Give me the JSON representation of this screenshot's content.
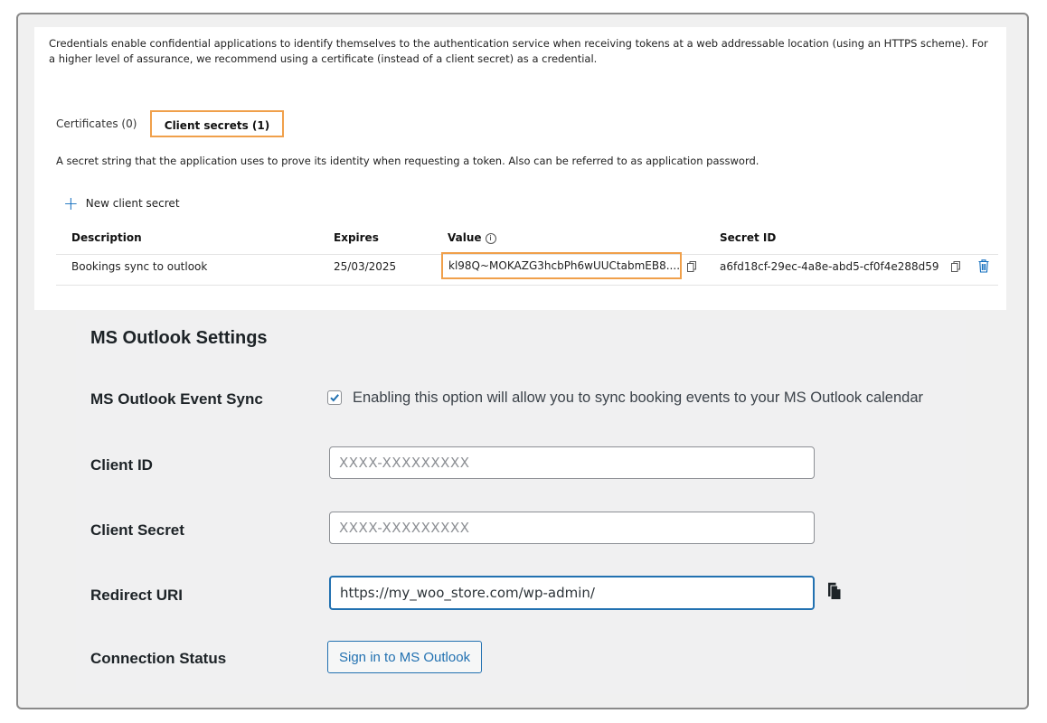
{
  "azure": {
    "intro_text": "Credentials enable confidential applications to identify themselves to the authentication service when receiving tokens at a web addressable location (using an HTTPS scheme). For a higher level of assurance, we recommend using a certificate (instead of a client secret) as a credential.",
    "tabs": [
      {
        "label": "Certificates (0)",
        "selected": false
      },
      {
        "label": "Client secrets (1)",
        "selected": true
      }
    ],
    "secrets_description": "A secret string that the application uses to prove its identity when requesting a token. Also can be referred to as application password.",
    "new_secret_label": "New client secret",
    "table": {
      "headers": {
        "description": "Description",
        "expires": "Expires",
        "value": "Value",
        "secret_id": "Secret ID"
      },
      "rows": [
        {
          "description": "Bookings sync to outlook",
          "expires": "25/03/2025",
          "value": "kl98Q~MOKAZG3hcbPh6wUUCtabmEB8....",
          "secret_id": "a6fd18cf-29ec-4a8e-abd5-cf0f4e288d59"
        }
      ]
    },
    "icons": {
      "add": "plus-icon",
      "info": "info-icon",
      "copy": "copy-icon",
      "delete": "trash-icon"
    },
    "accent_color": "#0f6cbd",
    "highlight_color": "#f0a04b"
  },
  "settings": {
    "title": "MS Outlook Settings",
    "event_sync": {
      "label": "MS Outlook Event Sync",
      "checked": true,
      "text": "Enabling this option will allow you to sync booking events to your MS Outlook calendar"
    },
    "client_id": {
      "label": "Client ID",
      "value": "",
      "placeholder": "XXXX-XXXXXXXXX"
    },
    "client_secret": {
      "label": "Client Secret",
      "value": "",
      "placeholder": "XXXX-XXXXXXXXX"
    },
    "redirect_uri": {
      "label": "Redirect URI",
      "value": "https://my_woo_store.com/wp-admin/"
    },
    "connection_status": {
      "label": "Connection Status",
      "button_label": "Sign in to MS Outlook"
    },
    "checkbox_color": "#2271b1"
  }
}
